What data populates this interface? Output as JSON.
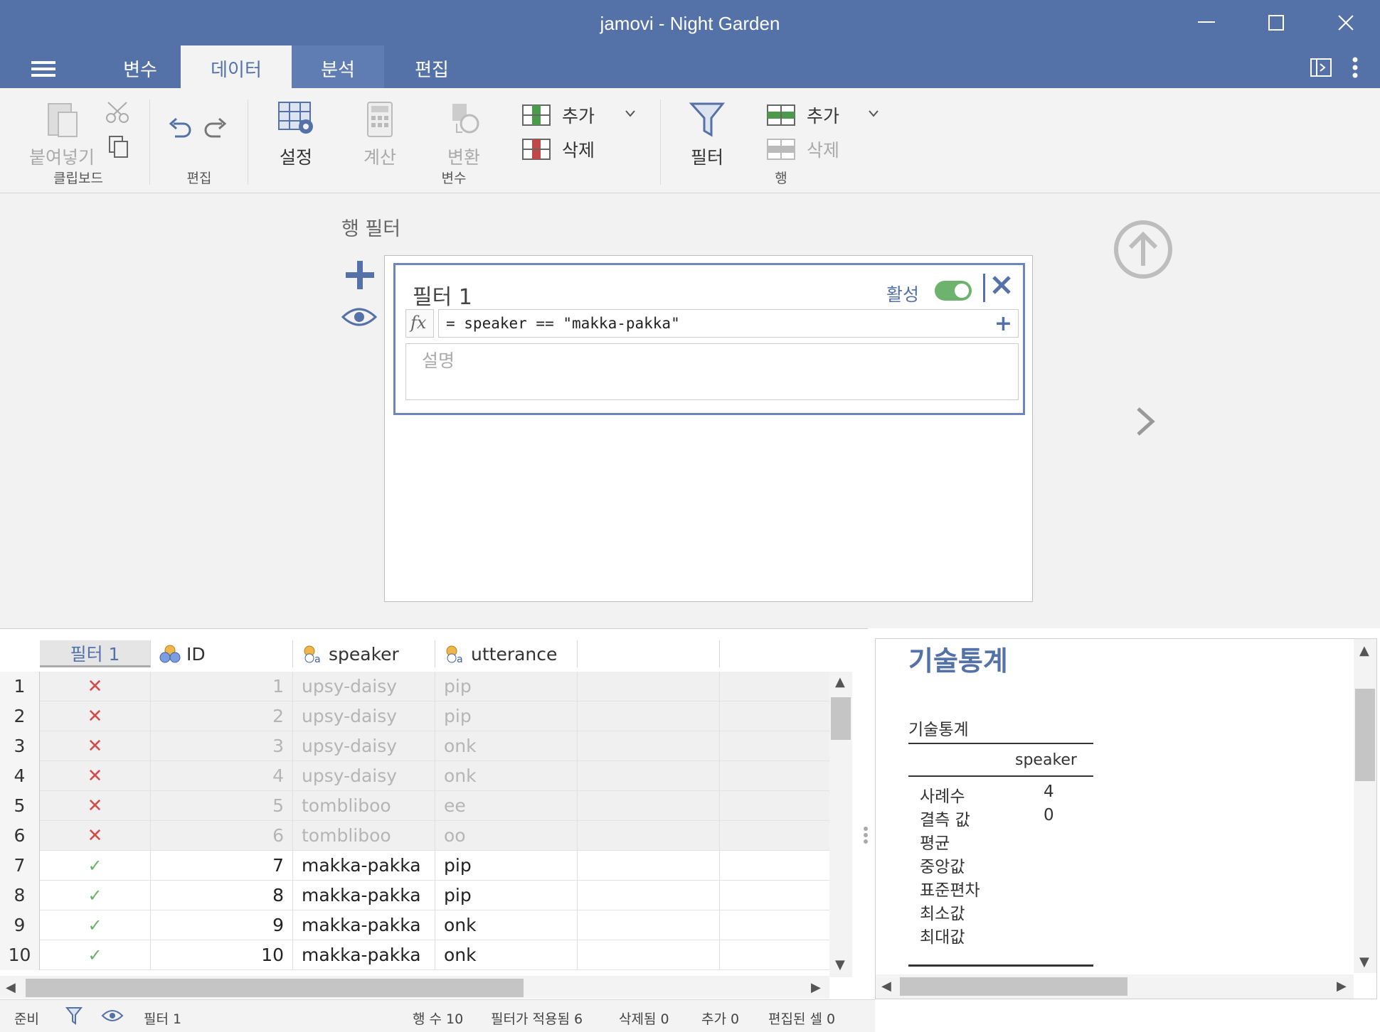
{
  "window": {
    "title": "jamovi - Night Garden",
    "minimize": "—",
    "maximize": "☐",
    "close": "✕"
  },
  "tabs": [
    {
      "label": "변수"
    },
    {
      "label": "데이터"
    },
    {
      "label": "분석"
    },
    {
      "label": "편집"
    }
  ],
  "active_tab": "데이터",
  "ribbon": {
    "paste": "붙여넣기",
    "clipboard_group": "클립보드",
    "edit_group": "편집",
    "setup": "설정",
    "compute": "계산",
    "transform": "변환",
    "var_add": "추가",
    "var_delete": "삭제",
    "variables_group": "변수",
    "filter": "필터",
    "row_add": "추가",
    "row_delete": "삭제",
    "rows_group": "행"
  },
  "filters_panel": {
    "title": "행 필터",
    "filter_name": "필터 1",
    "active_label": "활성",
    "active": true,
    "formula": "= speaker == \"makka-pakka\"",
    "description_placeholder": "설명"
  },
  "sheet": {
    "columns": [
      "필터 1",
      "ID",
      "speaker",
      "utterance"
    ],
    "rows": [
      {
        "n": "1",
        "pass": false,
        "id": "1",
        "speaker": "upsy-daisy",
        "utterance": "pip"
      },
      {
        "n": "2",
        "pass": false,
        "id": "2",
        "speaker": "upsy-daisy",
        "utterance": "pip"
      },
      {
        "n": "3",
        "pass": false,
        "id": "3",
        "speaker": "upsy-daisy",
        "utterance": "onk"
      },
      {
        "n": "4",
        "pass": false,
        "id": "4",
        "speaker": "upsy-daisy",
        "utterance": "onk"
      },
      {
        "n": "5",
        "pass": false,
        "id": "5",
        "speaker": "tombliboo",
        "utterance": "ee"
      },
      {
        "n": "6",
        "pass": false,
        "id": "6",
        "speaker": "tombliboo",
        "utterance": "oo"
      },
      {
        "n": "7",
        "pass": true,
        "id": "7",
        "speaker": "makka-pakka",
        "utterance": "pip"
      },
      {
        "n": "8",
        "pass": true,
        "id": "8",
        "speaker": "makka-pakka",
        "utterance": "pip"
      },
      {
        "n": "9",
        "pass": true,
        "id": "9",
        "speaker": "makka-pakka",
        "utterance": "onk"
      },
      {
        "n": "10",
        "pass": true,
        "id": "10",
        "speaker": "makka-pakka",
        "utterance": "onk"
      }
    ]
  },
  "results": {
    "heading": "기술통계",
    "table_title": "기술통계",
    "column": "speaker",
    "stats": [
      {
        "label": "사례수",
        "value": "4"
      },
      {
        "label": "결측 값",
        "value": "0"
      },
      {
        "label": "평균",
        "value": ""
      },
      {
        "label": "중앙값",
        "value": ""
      },
      {
        "label": "표준편차",
        "value": ""
      },
      {
        "label": "최소값",
        "value": ""
      },
      {
        "label": "최대값",
        "value": ""
      }
    ]
  },
  "status": {
    "ready": "준비",
    "filter": "필터 1",
    "row_count": "행 수 10",
    "filtered": "필터가 적용됨 6",
    "deleted": "삭제됨 0",
    "added": "추가 0",
    "edited": "편집된 셀 0"
  },
  "colors": {
    "accent": "#5471a8",
    "reject": "#d24b4b",
    "accept": "#69b369"
  }
}
